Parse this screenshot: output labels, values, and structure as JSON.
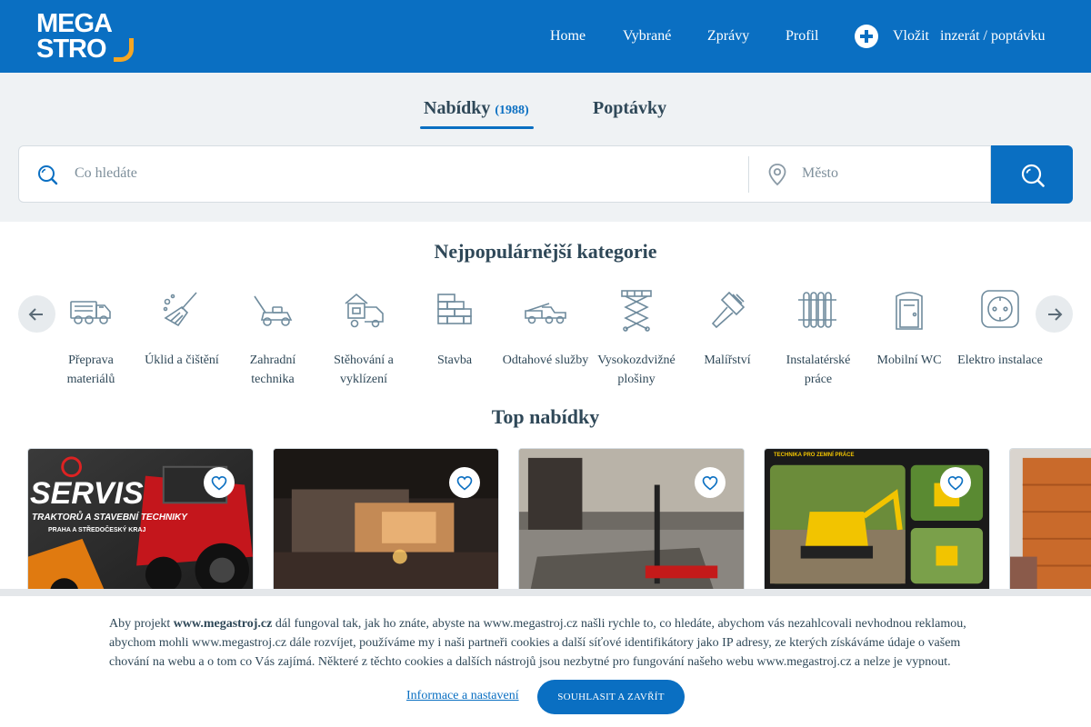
{
  "brand": {
    "line1": "MEGA",
    "line2": "STRO",
    "accent_color": "#f5a623",
    "primary_color": "#0a6fc2"
  },
  "nav": {
    "home": "Home",
    "selected": "Vybrané",
    "messages": "Zprávy",
    "profile": "Profil",
    "insert": "Vložit   inzerát / poptávku",
    "insert_icon": "plus-circle-icon"
  },
  "tabs": {
    "offers": "Nabídky",
    "offers_count": "(1988)",
    "requests": "Poptávky"
  },
  "search": {
    "query_placeholder": "Co hledáte",
    "city_placeholder": "Město",
    "query_icon": "search-icon",
    "city_icon": "location-pin-icon",
    "button_icon": "search-icon"
  },
  "categories": {
    "title": "Nejpopulárnější kategorie",
    "items": [
      {
        "label": "Přeprava materiálů",
        "icon": "truck-icon"
      },
      {
        "label": "Úklid a čištění",
        "icon": "broom-icon"
      },
      {
        "label": "Zahradní technika",
        "icon": "lawn-mower-icon"
      },
      {
        "label": "Stěhování a vyklízení",
        "icon": "moving-van-icon"
      },
      {
        "label": "Stavba",
        "icon": "bricks-icon"
      },
      {
        "label": "Odtahové služby",
        "icon": "tow-truck-icon"
      },
      {
        "label": "Vysokozdvižné plošiny",
        "icon": "scissor-lift-icon"
      },
      {
        "label": "Malířství",
        "icon": "paint-brush-icon"
      },
      {
        "label": "Instalatérské práce",
        "icon": "radiator-icon"
      },
      {
        "label": "Mobilní WC",
        "icon": "portable-toilet-icon"
      },
      {
        "label": "Elektro instalace",
        "icon": "power-socket-icon"
      }
    ]
  },
  "offers": {
    "title": "Top nabídky",
    "cards": [
      {
        "image": "tractor-service-photo",
        "overlay_line1": "SERVIS",
        "overlay_line2": "TRAKTORŮ A STAVEBNÍ TECHNIKY",
        "overlay_line3": "PRAHA A STŘEDOČESKÝ KRAJ"
      },
      {
        "image": "modern-house-night-photo"
      },
      {
        "image": "pallet-jack-warehouse-photo"
      },
      {
        "image": "mini-excavator-photo",
        "overlay_line1": "TECHNIKA PRO ZEMNÍ PRÁCE"
      },
      {
        "image": "garage-door-photo"
      }
    ]
  },
  "cookie": {
    "text_pre": "Aby projekt ",
    "text_bold": "www.megastroj.cz",
    "text_post": " dál fungoval tak, jak ho znáte, abyste na www.megastroj.cz našli rychle to, co hledáte, abychom vás nezahlcovali nevhodnou reklamou, abychom mohli www.megastroj.cz dále rozvíjet, používáme my i naši partneři cookies a další síťové identifikátory jako IP adresy, ze kterých získáváme údaje o vašem chování na webu a o tom co Vás zajímá. Některé z těchto cookies a dalších nástrojů jsou nezbytné pro fungování našeho webu www.megastroj.cz a nelze je vypnout.",
    "settings_link": "Informace a nastavení",
    "accept_button": "SOUHLASIT A ZAVŘÍT"
  }
}
